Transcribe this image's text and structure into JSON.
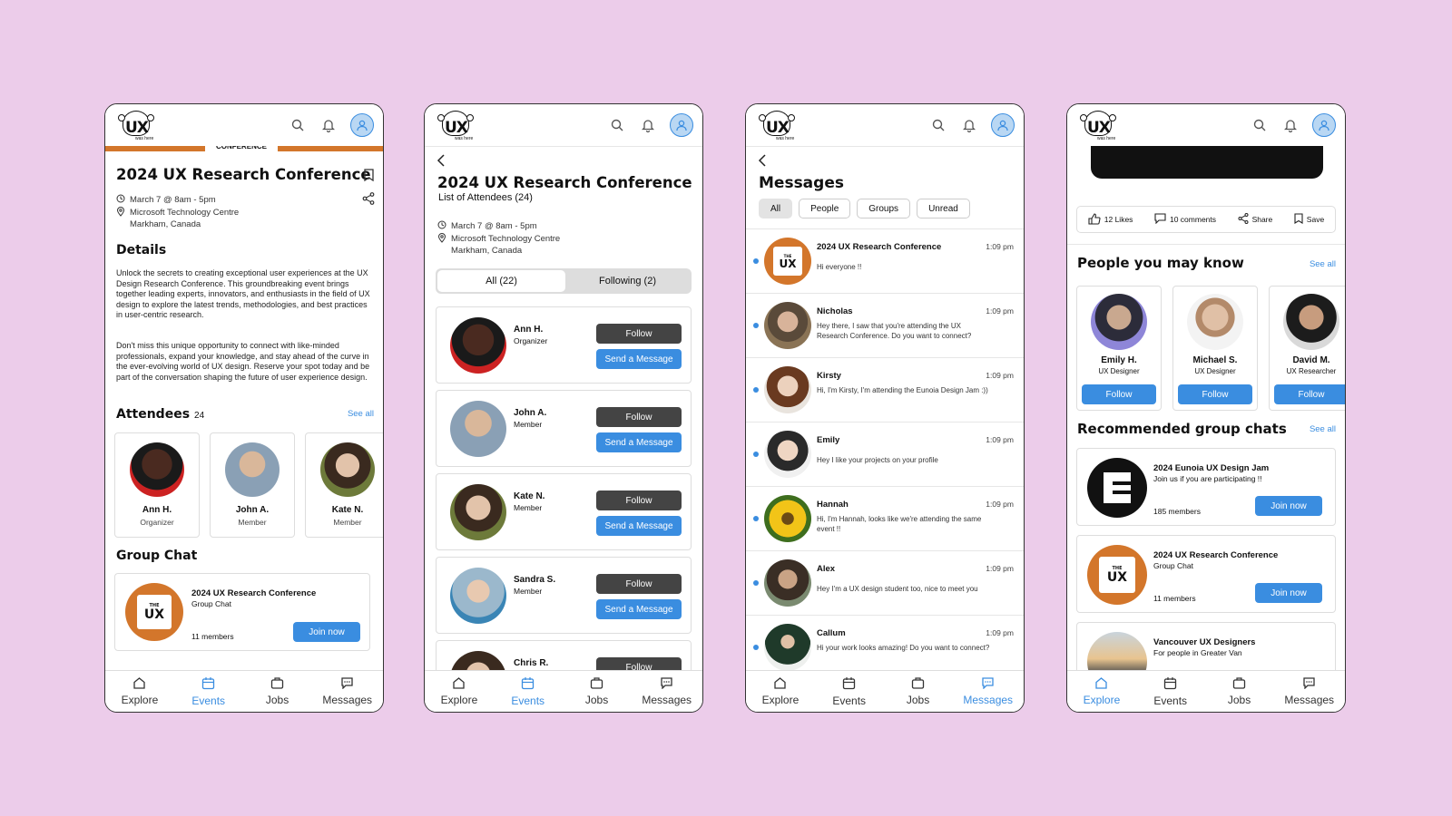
{
  "common": {
    "logo_text": "UX",
    "logo_sub": "was here",
    "nav": [
      "Explore",
      "Events",
      "Jobs",
      "Messages"
    ]
  },
  "p1": {
    "banner": "CONFERENCE",
    "title": "2024 UX Research Conference",
    "date": "March 7 @ 8am - 5pm",
    "venue": "Microsoft Technology Centre",
    "city": "Markham, Canada",
    "details_heading": "Details",
    "details_p1": "Unlock the secrets to creating exceptional user experiences at the UX Design Research Conference. This groundbreaking event brings together leading experts, innovators, and enthusiasts in the field of UX design to explore the latest trends, methodologies, and best practices in user-centric research.",
    "details_p2": "Don't miss this unique opportunity to connect with like-minded professionals, expand your knowledge, and stay ahead of the curve in the ever-evolving world of UX design. Reserve your spot today and be part of the conversation shaping the future of user experience design.",
    "attendees_heading": "Attendees",
    "attendees_count": "24",
    "see_all": "See all",
    "attendees": [
      {
        "name": "Ann H.",
        "role": "Organizer"
      },
      {
        "name": "John A.",
        "role": "Member"
      },
      {
        "name": "Kate N.",
        "role": "Member"
      }
    ],
    "group_heading": "Group Chat",
    "group": {
      "name": "2024 UX Research Conference",
      "type": "Group Chat",
      "members": "11 members",
      "join": "Join now"
    }
  },
  "p2": {
    "title": "2024 UX Research Conference",
    "subtitle": "List of Attendees (24)",
    "date": "March 7 @ 8am - 5pm",
    "venue": "Microsoft Technology Centre",
    "city": "Markham, Canada",
    "tab_all": "All (22)",
    "tab_following": "Following (2)",
    "follow": "Follow",
    "message": "Send a Message",
    "people": [
      {
        "name": "Ann H.",
        "role": "Organizer"
      },
      {
        "name": "John A.",
        "role": "Member"
      },
      {
        "name": "Kate N.",
        "role": "Member"
      },
      {
        "name": "Sandra S.",
        "role": "Member"
      },
      {
        "name": "Chris R.",
        "role": ""
      }
    ]
  },
  "p3": {
    "title": "Messages",
    "filters": [
      "All",
      "People",
      "Groups",
      "Unread"
    ],
    "messages": [
      {
        "name": "2024 UX Research Conference",
        "time": "1:09 pm",
        "text": "Hi everyone !!"
      },
      {
        "name": "Nicholas",
        "time": "1:09 pm",
        "text": "Hey there, I saw that you're attending the UX Research Conference.  Do you want to connect?"
      },
      {
        "name": "Kirsty",
        "time": "1:09 pm",
        "text": "Hi, I'm Kirsty, I'm attending the Eunoia Design Jam :))"
      },
      {
        "name": "Emily",
        "time": "1:09 pm",
        "text": "Hey I like your projects on your profile"
      },
      {
        "name": "Hannah",
        "time": "1:09 pm",
        "text": "Hi, I'm Hannah, looks like we're attending the same event !!"
      },
      {
        "name": "Alex",
        "time": "1:09 pm",
        "text": "Hey I'm a UX design student too, nice to meet you"
      },
      {
        "name": "Callum",
        "time": "1:09 pm",
        "text": "Hi your work looks amazing! Do you want to connect?"
      }
    ]
  },
  "p4": {
    "likes": "12 Likes",
    "comments": "10 comments",
    "share": "Share",
    "save": "Save",
    "pymk_heading": "People you may know",
    "see_all": "See all",
    "follow": "Follow",
    "people": [
      {
        "name": "Emily H.",
        "role": "UX Designer"
      },
      {
        "name": "Michael S.",
        "role": "UX Designer"
      },
      {
        "name": "David M.",
        "role": "UX Researcher"
      }
    ],
    "rec_heading": "Recommended group chats",
    "join": "Join now",
    "groups": [
      {
        "name": "2024 Eunoia UX Design Jam",
        "desc": "Join us if you are participating !!",
        "members": "185 members"
      },
      {
        "name": "2024 UX Research Conference",
        "desc": "Group Chat",
        "members": "11 members"
      },
      {
        "name": "Vancouver UX Designers",
        "desc": "For people in Greater Van",
        "members": ""
      }
    ]
  }
}
